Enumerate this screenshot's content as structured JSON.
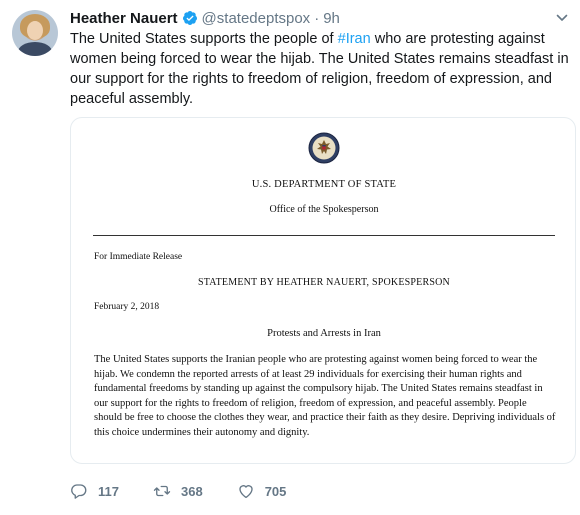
{
  "tweet": {
    "author_name": "Heather Nauert",
    "handle": "@statedeptspox",
    "separator": "·",
    "time": "9h",
    "text_before": "The United States supports the people of ",
    "hashtag": "#Iran",
    "text_after": " who are protesting against women being forced to wear the hijab. The United States remains steadfast in our support for the rights to freedom of religion, freedom of expression, and peaceful assembly."
  },
  "document": {
    "department": "U.S. DEPARTMENT OF STATE",
    "office": "Office of the Spokesperson",
    "release": "For Immediate Release",
    "statement_title": "STATEMENT BY HEATHER NAUERT, SPOKESPERSON",
    "date": "February 2, 2018",
    "subject": "Protests and Arrests in Iran",
    "body": "The United States supports the Iranian people who are protesting against women being forced to wear the hijab. We condemn the reported arrests of at least 29 individuals for exercising their human rights and fundamental freedoms by standing up against the compulsory hijab. The United States remains steadfast in our support for the rights to freedom of religion, freedom of expression, and peaceful assembly. People should be free to choose the clothes they wear, and practice their faith as they desire. Depriving individuals of this choice undermines their autonomy and dignity."
  },
  "actions": {
    "replies": "117",
    "retweets": "368",
    "likes": "705"
  },
  "icons": {
    "verified": "verified-badge-icon",
    "chevron": "chevron-down-icon",
    "reply": "reply-icon",
    "retweet": "retweet-icon",
    "like": "heart-icon",
    "seal": "state-department-seal-icon"
  },
  "colors": {
    "link": "#1da1f2",
    "secondary_text": "#657786",
    "border": "#e6ecf0"
  }
}
